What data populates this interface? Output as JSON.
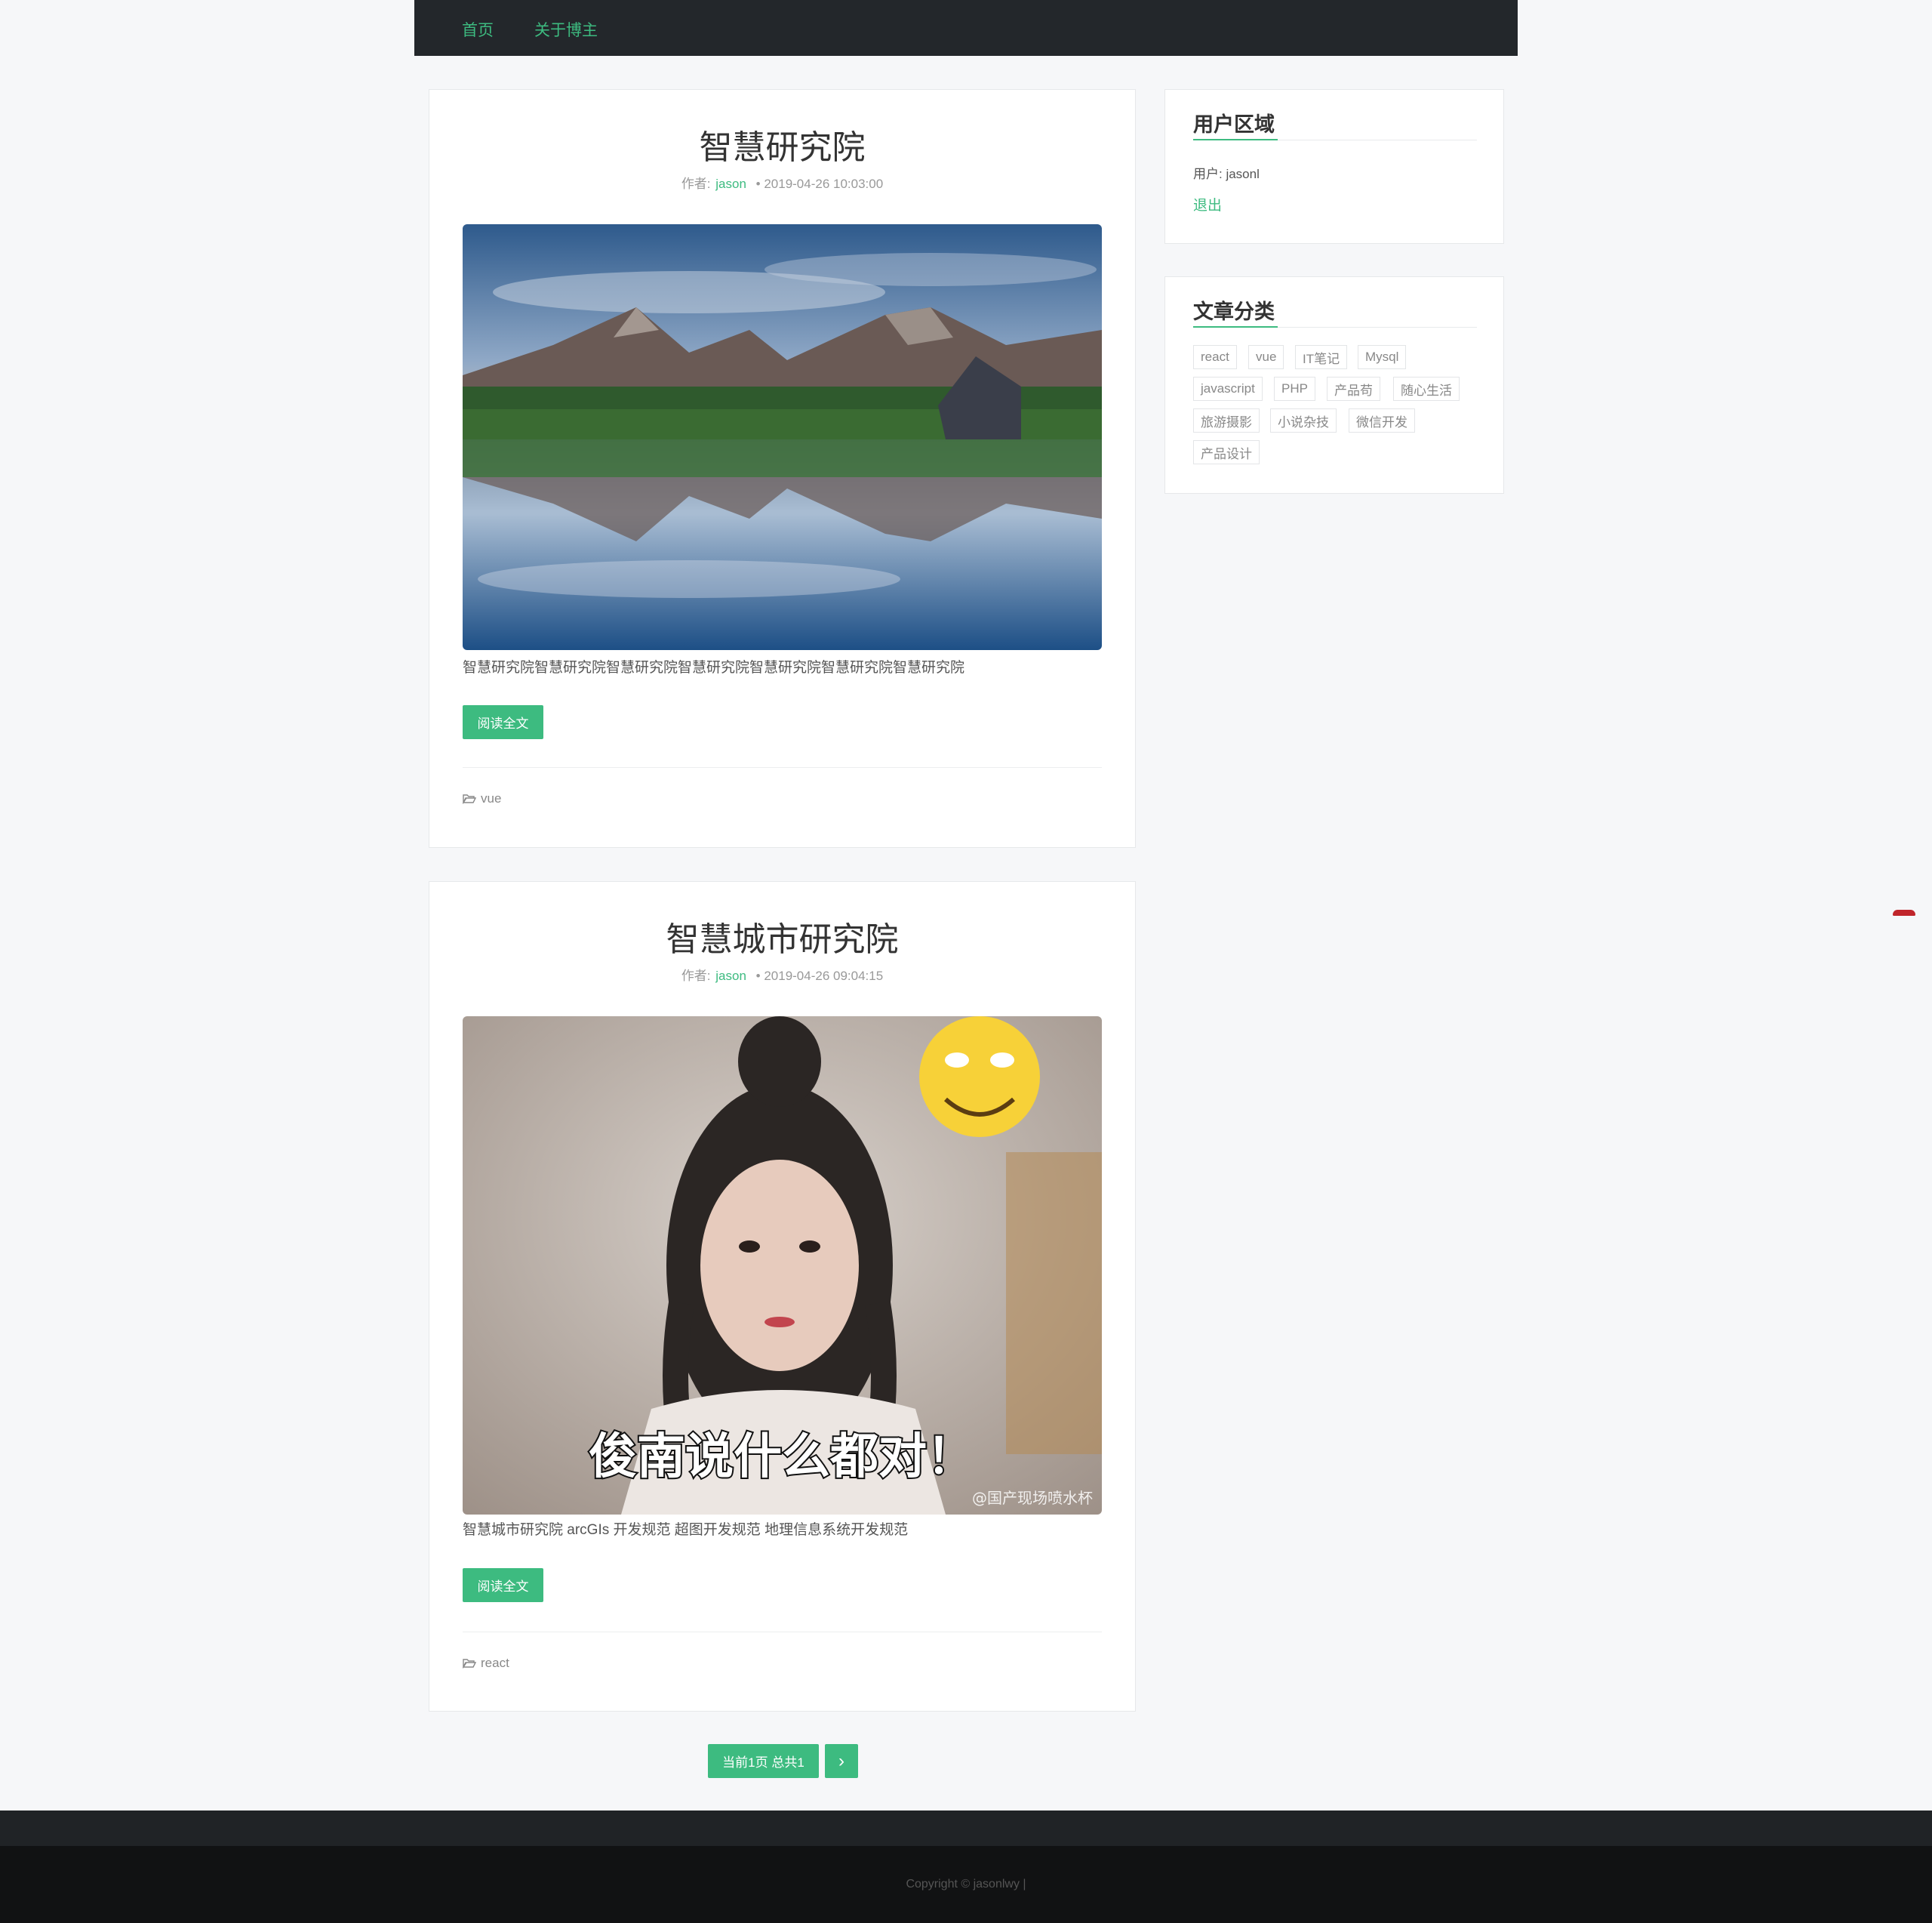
{
  "nav": {
    "items": [
      "首页",
      "关于博主"
    ]
  },
  "posts": [
    {
      "title": "智慧研究院",
      "author_label": "作者:",
      "author": "jason",
      "date": "• 2019-04-26 10:03:00",
      "excerpt": "智慧研究院智慧研究院智慧研究院智慧研究院智慧研究院智慧研究院智慧研究院",
      "read_more": "阅读全文",
      "tag": "vue"
    },
    {
      "title": "智慧城市研究院",
      "author_label": "作者:",
      "author": "jason",
      "date": "• 2019-04-26 09:04:15",
      "excerpt": "智慧城市研究院 arcGIs 开发规范 超图开发规范 地理信息系统开发规范",
      "read_more": "阅读全文",
      "tag": "react",
      "image_caption": "俊南说什么都对！",
      "watermark": "@国产现场喷水杯"
    }
  ],
  "sidebar": {
    "user_widget": {
      "title": "用户区域",
      "user_line": "用户: jasonl",
      "logout": "退出"
    },
    "category_widget": {
      "title": "文章分类",
      "tags": [
        "react",
        "vue",
        "IT笔记",
        "Mysql",
        "javascript",
        "PHP",
        "产品苟",
        "随心生活",
        "旅游摄影",
        "小说杂技",
        "微信开发",
        "产品设计"
      ]
    }
  },
  "pagination": {
    "current": "当前1页 总共1",
    "next": "›"
  },
  "footer": {
    "copyright": "Copyright © jasonlwy   |"
  },
  "colors": {
    "accent": "#3dbb80",
    "nav_bg": "#23272b",
    "page_bg": "#f6f7f9"
  }
}
